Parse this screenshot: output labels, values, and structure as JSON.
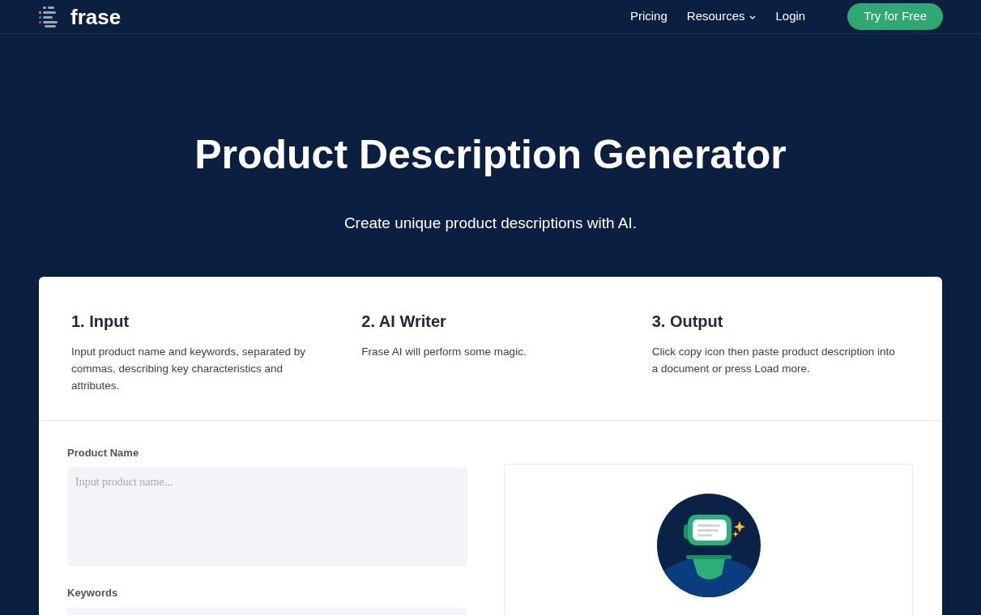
{
  "nav": {
    "logo": "frase",
    "links": [
      {
        "label": "Pricing",
        "kind": "link"
      },
      {
        "label": "Resources",
        "kind": "dropdown"
      },
      {
        "label": "Login",
        "kind": "link"
      }
    ],
    "cta": "Try for Free"
  },
  "hero": {
    "title": "Product Description Generator",
    "subtitle": "Create unique product descriptions with AI."
  },
  "steps": [
    {
      "title": "1. Input",
      "text": "Input product name and keywords, separated by commas, describing key characteristics and attributes."
    },
    {
      "title": "2. AI Writer",
      "text": "Frase AI will perform some magic."
    },
    {
      "title": "3. Output",
      "text": "Click copy icon then paste product description into a document or press Load more."
    }
  ],
  "form": {
    "fields": [
      {
        "label": "Product Name",
        "placeholder": "Input product name..."
      },
      {
        "label": "Keywords"
      }
    ]
  }
}
